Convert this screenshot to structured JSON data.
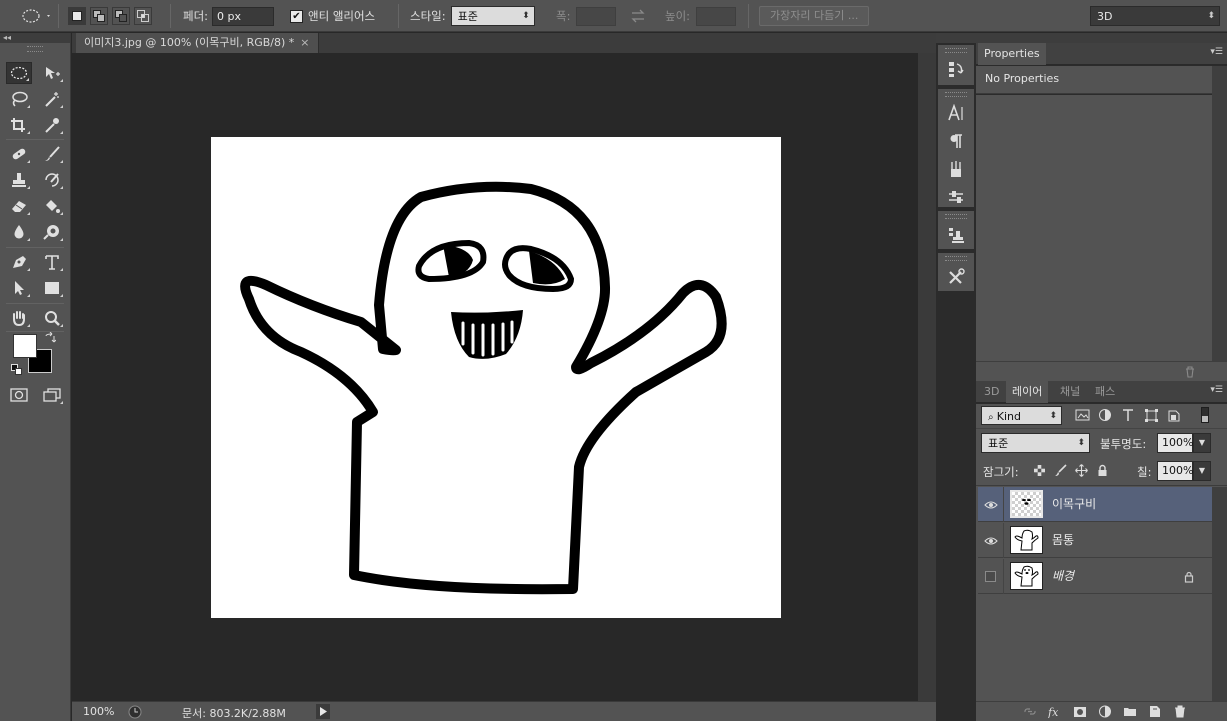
{
  "options_bar": {
    "feather_label": "페더:",
    "feather_value": "0 px",
    "antialias_label": "앤티 앨리어스",
    "antialias_checked": true,
    "style_label": "스타일:",
    "style_value": "표준",
    "width_label": "폭:",
    "height_label": "높이:",
    "refine_edge_button": "가장자리 다듬기 ...",
    "workspace_value": "3D"
  },
  "document": {
    "tab_title": "이미지3.jpg @ 100% (이목구비, RGB/8) *",
    "tab_close": "×"
  },
  "status_bar": {
    "zoom": "100%",
    "doc_info": "문서: 803.2K/2.88M"
  },
  "properties_panel": {
    "tab": "Properties",
    "content": "No Properties"
  },
  "layers_panel": {
    "tabs": [
      "3D",
      "레이어",
      "채널",
      "패스"
    ],
    "active_tab": "레이어",
    "filter_kind": "Kind",
    "blend_mode": "표준",
    "opacity_label": "불투명도:",
    "opacity_value": "100%",
    "lock_label": "잠그기:",
    "fill_label": "칠:",
    "fill_value": "100%",
    "layers": [
      {
        "name": "이목구비",
        "visible": true,
        "selected": true,
        "locked": false
      },
      {
        "name": "몸통",
        "visible": true,
        "selected": false,
        "locked": false
      },
      {
        "name": "배경",
        "visible": false,
        "selected": false,
        "locked": true
      }
    ]
  },
  "colors": {
    "foreground": "#ffffff",
    "background": "#000000",
    "selected_layer": "#56617a"
  }
}
